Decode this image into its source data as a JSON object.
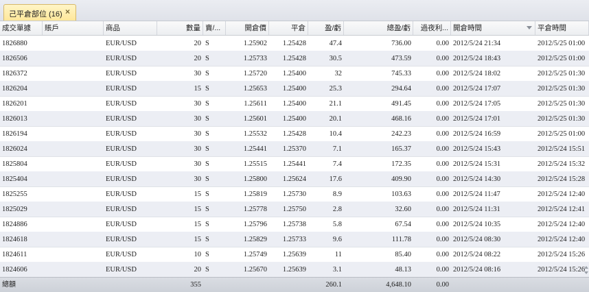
{
  "tab": {
    "label": "己平倉部位 (16)",
    "close_glyph": "×"
  },
  "columns": [
    {
      "key": "id",
      "label": "成交單據"
    },
    {
      "key": "account",
      "label": "賬戶"
    },
    {
      "key": "product",
      "label": "商品"
    },
    {
      "key": "qty",
      "label": "數量"
    },
    {
      "key": "side",
      "label": "賣/..."
    },
    {
      "key": "open_price",
      "label": "開倉價"
    },
    {
      "key": "close_price",
      "label": "平倉"
    },
    {
      "key": "pips",
      "label": "盈/虧"
    },
    {
      "key": "total_pl",
      "label": "總盈/虧"
    },
    {
      "key": "overnight",
      "label": "過夜利..."
    },
    {
      "key": "open_time",
      "label": "開倉時間"
    },
    {
      "key": "close_time",
      "label": "平倉時間"
    }
  ],
  "rows": [
    {
      "id": "1826880",
      "account": "",
      "product": "EUR/USD",
      "qty": "20",
      "side": "S",
      "open_price": "1.25902",
      "close_price": "1.25428",
      "pips": "47.4",
      "total_pl": "736.00",
      "overnight": "0.00",
      "open_time": "2012/5/24 21:34",
      "close_time": "2012/5/25 01:00"
    },
    {
      "id": "1826506",
      "account": "",
      "product": "EUR/USD",
      "qty": "20",
      "side": "S",
      "open_price": "1.25733",
      "close_price": "1.25428",
      "pips": "30.5",
      "total_pl": "473.59",
      "overnight": "0.00",
      "open_time": "2012/5/24 18:43",
      "close_time": "2012/5/25 01:00"
    },
    {
      "id": "1826372",
      "account": "",
      "product": "EUR/USD",
      "qty": "30",
      "side": "S",
      "open_price": "1.25720",
      "close_price": "1.25400",
      "pips": "32",
      "total_pl": "745.33",
      "overnight": "0.00",
      "open_time": "2012/5/24 18:02",
      "close_time": "2012/5/25 01:30"
    },
    {
      "id": "1826204",
      "account": "",
      "product": "EUR/USD",
      "qty": "15",
      "side": "S",
      "open_price": "1.25653",
      "close_price": "1.25400",
      "pips": "25.3",
      "total_pl": "294.64",
      "overnight": "0.00",
      "open_time": "2012/5/24 17:07",
      "close_time": "2012/5/25 01:30"
    },
    {
      "id": "1826201",
      "account": "",
      "product": "EUR/USD",
      "qty": "30",
      "side": "S",
      "open_price": "1.25611",
      "close_price": "1.25400",
      "pips": "21.1",
      "total_pl": "491.45",
      "overnight": "0.00",
      "open_time": "2012/5/24 17:05",
      "close_time": "2012/5/25 01:30"
    },
    {
      "id": "1826013",
      "account": "",
      "product": "EUR/USD",
      "qty": "30",
      "side": "S",
      "open_price": "1.25601",
      "close_price": "1.25400",
      "pips": "20.1",
      "total_pl": "468.16",
      "overnight": "0.00",
      "open_time": "2012/5/24 17:01",
      "close_time": "2012/5/25 01:30"
    },
    {
      "id": "1826194",
      "account": "",
      "product": "EUR/USD",
      "qty": "30",
      "side": "S",
      "open_price": "1.25532",
      "close_price": "1.25428",
      "pips": "10.4",
      "total_pl": "242.23",
      "overnight": "0.00",
      "open_time": "2012/5/24 16:59",
      "close_time": "2012/5/25 01:00"
    },
    {
      "id": "1826024",
      "account": "",
      "product": "EUR/USD",
      "qty": "30",
      "side": "S",
      "open_price": "1.25441",
      "close_price": "1.25370",
      "pips": "7.1",
      "total_pl": "165.37",
      "overnight": "0.00",
      "open_time": "2012/5/24 15:43",
      "close_time": "2012/5/24 15:51"
    },
    {
      "id": "1825804",
      "account": "",
      "product": "EUR/USD",
      "qty": "30",
      "side": "S",
      "open_price": "1.25515",
      "close_price": "1.25441",
      "pips": "7.4",
      "total_pl": "172.35",
      "overnight": "0.00",
      "open_time": "2012/5/24 15:31",
      "close_time": "2012/5/24 15:32"
    },
    {
      "id": "1825404",
      "account": "",
      "product": "EUR/USD",
      "qty": "30",
      "side": "S",
      "open_price": "1.25800",
      "close_price": "1.25624",
      "pips": "17.6",
      "total_pl": "409.90",
      "overnight": "0.00",
      "open_time": "2012/5/24 14:30",
      "close_time": "2012/5/24 15:28"
    },
    {
      "id": "1825255",
      "account": "",
      "product": "EUR/USD",
      "qty": "15",
      "side": "S",
      "open_price": "1.25819",
      "close_price": "1.25730",
      "pips": "8.9",
      "total_pl": "103.63",
      "overnight": "0.00",
      "open_time": "2012/5/24 11:47",
      "close_time": "2012/5/24 12:40"
    },
    {
      "id": "1825029",
      "account": "",
      "product": "EUR/USD",
      "qty": "15",
      "side": "S",
      "open_price": "1.25778",
      "close_price": "1.25750",
      "pips": "2.8",
      "total_pl": "32.60",
      "overnight": "0.00",
      "open_time": "2012/5/24 11:31",
      "close_time": "2012/5/24 12:41"
    },
    {
      "id": "1824886",
      "account": "",
      "product": "EUR/USD",
      "qty": "15",
      "side": "S",
      "open_price": "1.25796",
      "close_price": "1.25738",
      "pips": "5.8",
      "total_pl": "67.54",
      "overnight": "0.00",
      "open_time": "2012/5/24 10:35",
      "close_time": "2012/5/24 12:40"
    },
    {
      "id": "1824618",
      "account": "",
      "product": "EUR/USD",
      "qty": "15",
      "side": "S",
      "open_price": "1.25829",
      "close_price": "1.25733",
      "pips": "9.6",
      "total_pl": "111.78",
      "overnight": "0.00",
      "open_time": "2012/5/24 08:30",
      "close_time": "2012/5/24 12:40"
    },
    {
      "id": "1824611",
      "account": "",
      "product": "EUR/USD",
      "qty": "10",
      "side": "S",
      "open_price": "1.25749",
      "close_price": "1.25639",
      "pips": "11",
      "total_pl": "85.40",
      "overnight": "0.00",
      "open_time": "2012/5/24 08:22",
      "close_time": "2012/5/24 15:26"
    },
    {
      "id": "1824606",
      "account": "",
      "product": "EUR/USD",
      "qty": "20",
      "side": "S",
      "open_price": "1.25670",
      "close_price": "1.25639",
      "pips": "3.1",
      "total_pl": "48.13",
      "overnight": "0.00",
      "open_time": "2012/5/24 08:16",
      "close_time": "2012/5/24 15:26"
    }
  ],
  "totals": {
    "label": "總額",
    "qty": "355",
    "pips": "260.1",
    "total_pl": "4,648.10",
    "overnight": "0.00"
  }
}
